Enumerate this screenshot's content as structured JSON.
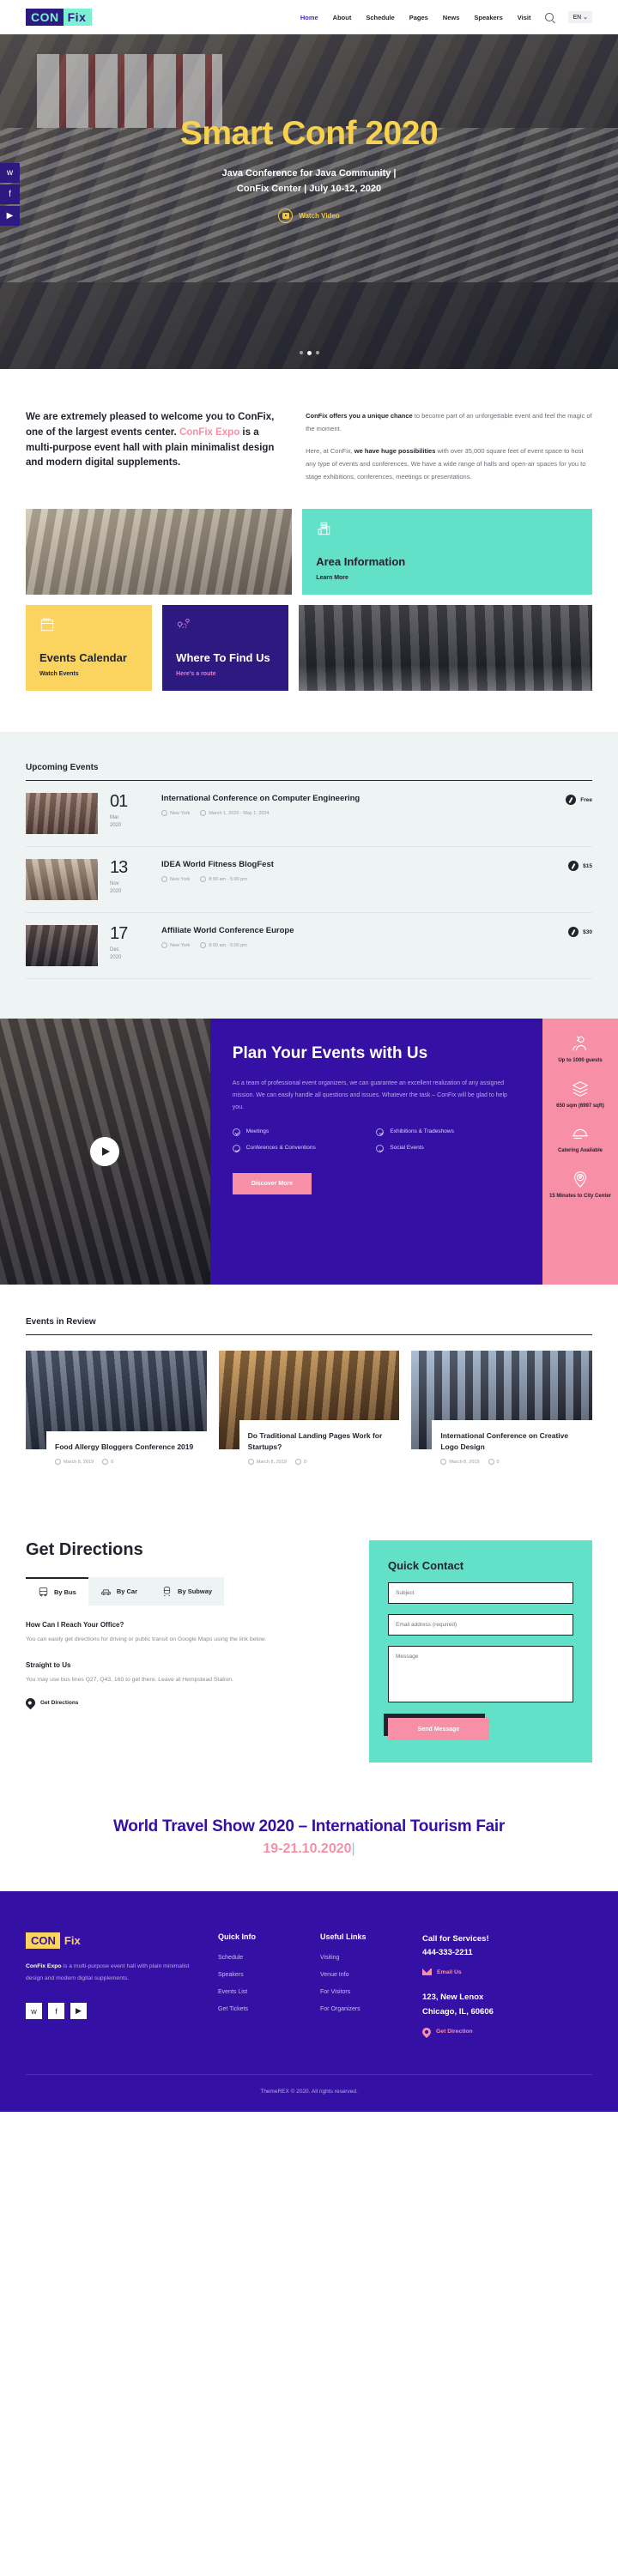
{
  "header": {
    "logo": {
      "part1": "CON",
      "part2": "Fix"
    },
    "nav": [
      {
        "label": "Home",
        "active": true
      },
      {
        "label": "About",
        "active": false
      },
      {
        "label": "Schedule",
        "active": false
      },
      {
        "label": "Pages",
        "active": false
      },
      {
        "label": "News",
        "active": false
      },
      {
        "label": "Speakers",
        "active": false
      },
      {
        "label": "Visit",
        "active": false
      }
    ],
    "search_icon": "search-icon",
    "language": "EN ⌄"
  },
  "hero": {
    "title": "Smart Conf 2020",
    "subtitle_line1": "Java Conference for Java Community |",
    "subtitle_line2": "ConFix Center | July 10-12, 2020",
    "watch_video": "Watch Video",
    "social": [
      "twitter-icon",
      "facebook-icon",
      "youtube-icon"
    ],
    "slide_count": 3,
    "active_slide": 1
  },
  "intro": {
    "headline_a": "We are extremely pleased to welcome you to ConFix, one of the largest events center. ",
    "headline_highlight": "ConFix Expo",
    "headline_b": " is a multi-purpose event hall with plain minimalist design and modern digital supplements.",
    "para1_bold": "ConFix offers you a unique chance",
    "para1_rest": " to become part of an unforgettable event and feel the magic of the moment.",
    "para2_a": "Here, at ConFix, ",
    "para2_bold": "we have huge possibilities",
    "para2_b": " with over 35,000 square feet of event space to host any type of events and conferences. We have a wide range of halls and open-air spaces for you to stage exhibitions, conferences, meetings or presentations."
  },
  "cards": {
    "area": {
      "title": "Area Information",
      "sub": "Learn More",
      "icon": "building-icon"
    },
    "calendar": {
      "title": "Events Calendar",
      "sub": "Watch Events",
      "icon": "calendar-icon"
    },
    "find": {
      "title": "Where To Find Us",
      "sub": "Here's a route",
      "icon": "map-route-icon"
    }
  },
  "upcoming": {
    "title": "Upcoming Events",
    "events": [
      {
        "day": "01",
        "month": "Mar",
        "year": "2020",
        "name": "International Conference on Computer Engineering",
        "location": "New York",
        "time": "March 1, 2020 - May 1, 2024",
        "price": "Free"
      },
      {
        "day": "13",
        "month": "Nov",
        "year": "2020",
        "name": "IDEA World Fitness BlogFest",
        "location": "New York",
        "time": "8:00 am - 5:00 pm",
        "price": "$15"
      },
      {
        "day": "17",
        "month": "Dec",
        "year": "2020",
        "name": "Affiliate World Conference Europe",
        "location": "New York",
        "time": "8:00 am - 5:00 pm",
        "price": "$30"
      }
    ]
  },
  "plan": {
    "title": "Plan Your Events with Us",
    "text": "As a team of professional event organizers, we can guarantee an excellent realization of any assigned mission. We can easily handle all questions and  issues. Whatever the task – ConFix will be glad to help you.",
    "features": [
      "Meetings",
      "Exhibitions & Tradeshows",
      "Conferences & Conventions",
      "Social Events"
    ],
    "button": "Discover More",
    "stats": [
      {
        "icon": "guests-icon",
        "label": "Up to 1000 guests"
      },
      {
        "icon": "layers-icon",
        "label": "650 sqm (6997 sqft)"
      },
      {
        "icon": "catering-icon",
        "label": "Catering Available"
      },
      {
        "icon": "parking-pin-icon",
        "label": "15 Minutes to City Center"
      }
    ]
  },
  "review": {
    "title": "Events in Review",
    "posts": [
      {
        "name": "Food Allergy Bloggers Conference 2019",
        "date": "March 8, 2019",
        "comments": "0"
      },
      {
        "name": "Do Traditional Landing Pages Work for Startups?",
        "date": "March 8, 2019",
        "comments": "0"
      },
      {
        "name": "International Conference on Creative Logo Design",
        "date": "March 8, 2019",
        "comments": "0"
      }
    ]
  },
  "directions": {
    "title": "Get Directions",
    "tabs": [
      {
        "label": "By Bus",
        "icon": "bus-icon",
        "active": true
      },
      {
        "label": "By Car",
        "icon": "car-icon",
        "active": false
      },
      {
        "label": "By Subway",
        "icon": "subway-icon",
        "active": false
      }
    ],
    "q1_title": "How Can I Reach Your Office?",
    "q1_text": "You can easily get directions for driving or public transit on Google Maps using the link below.",
    "q2_title": "Straight to Us",
    "q2_text": "You may use bus lines Q27, Q43, 160 to get there. Leave at Hempstead Station.",
    "link": "Get Directions"
  },
  "contact": {
    "title": "Quick Contact",
    "subject_placeholder": "Subject",
    "email_placeholder": "Email address (required)",
    "message_placeholder": "Message",
    "button": "Send Message"
  },
  "promo": {
    "title": "World Travel Show 2020 – International Tourism Fair",
    "date": "19-21.10.2020",
    "caret": "|"
  },
  "footer": {
    "logo": {
      "part1": "CON",
      "part2": "Fix"
    },
    "about_bold": "ConFix Expo",
    "about_rest": " is a multi-purpose event hall with plain minimalist design and modern digital supplements.",
    "social": [
      "twitter-icon",
      "facebook-icon",
      "youtube-icon"
    ],
    "quick_info": {
      "title": "Quick Info",
      "items": [
        "Schedule",
        "Speakers",
        "Events List",
        "Get Tickets"
      ]
    },
    "useful_links": {
      "title": "Useful Links",
      "items": [
        "Visiting",
        "Venue Info",
        "For Visitors",
        "For Organizers"
      ]
    },
    "services": {
      "title_line1": "Call for Services!",
      "title_line2": "444-333-2211",
      "email": "Email Us",
      "addr_line1": "123, New Lenox",
      "addr_line2": "Chicago, IL, 60606",
      "direction": "Get Direction"
    },
    "copyright": "ThemeREX © 2020. All rights reserved."
  },
  "colors": {
    "purple": "#3410a5",
    "deep_purple": "#2c1a80",
    "teal": "#62e0c8",
    "pink": "#f78fa7",
    "yellow": "#fbd45f",
    "hero_yellow": "#f6d250"
  }
}
